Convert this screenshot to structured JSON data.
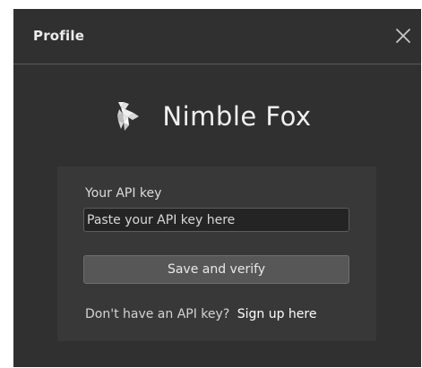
{
  "window": {
    "title": "Profile"
  },
  "brand": {
    "name": "Nimble Fox",
    "logo_icon": "fox-logo-icon"
  },
  "form": {
    "label": "Your API key",
    "input_value": "",
    "input_placeholder": "Paste your API key here",
    "save_label": "Save and verify",
    "signup_prompt": "Don't have an API key?",
    "signup_link": "Sign up here"
  },
  "colors": {
    "window_bg": "#303030",
    "card_bg": "#383838",
    "input_bg": "#242424",
    "button_bg": "#575757",
    "text": "#e6e6e6"
  }
}
